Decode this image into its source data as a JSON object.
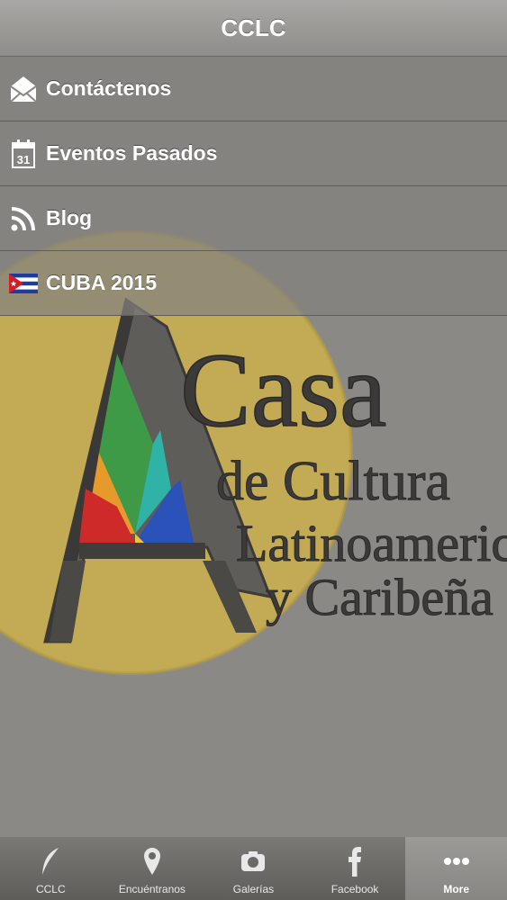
{
  "header": {
    "title": "CCLC"
  },
  "menu": {
    "items": [
      {
        "label": "Contáctenos",
        "icon": "envelope-icon"
      },
      {
        "label": "Eventos Pasados",
        "icon": "calendar-icon",
        "calendar_day": "31"
      },
      {
        "label": "Blog",
        "icon": "rss-icon"
      },
      {
        "label": "CUBA 2015",
        "icon": "cuba-flag-icon"
      }
    ]
  },
  "logo": {
    "line1": "Casa",
    "line2": "de Cultura",
    "line3": "Latinoamericana",
    "line4": "y Caribeña"
  },
  "tabbar": {
    "items": [
      {
        "label": "CCLC",
        "icon": "feather-icon"
      },
      {
        "label": "Encuéntranos",
        "icon": "map-pin-icon"
      },
      {
        "label": "Galerías",
        "icon": "camera-icon"
      },
      {
        "label": "Facebook",
        "icon": "facebook-icon"
      },
      {
        "label": "More",
        "icon": "more-dots-icon",
        "active": true
      }
    ]
  },
  "colors": {
    "header": "#9c9a97",
    "menu_bg": "#82817e",
    "tab_active": "#908f8c",
    "cuba_blue": "#1f3c9c",
    "cuba_red": "#d21f26"
  }
}
